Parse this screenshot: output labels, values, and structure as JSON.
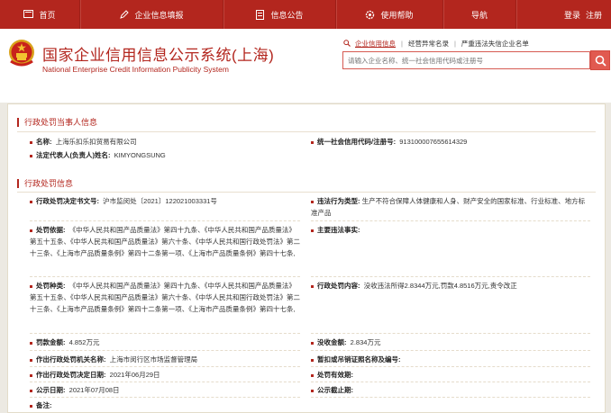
{
  "nav": {
    "items": [
      {
        "label": "首页",
        "icon": "home-icon"
      },
      {
        "label": "企业信息填报",
        "icon": "pencil-icon"
      },
      {
        "label": "信息公告",
        "icon": "document-icon"
      },
      {
        "label": "使用帮助",
        "icon": "gear-icon"
      },
      {
        "label": "导航",
        "icon": ""
      }
    ],
    "login": "登录",
    "register": "注册"
  },
  "header": {
    "title": "国家企业信用信息公示系统(上海)",
    "subtitle": "National Enterprise Credit Information Publicity System",
    "search_links": [
      "企业信用信息",
      "经营异常名录",
      "严重违法失信企业名单"
    ],
    "search_placeholder": "请输入企业名称、统一社会信用代码或注册号"
  },
  "party": {
    "section_title": "行政处罚当事人信息",
    "name_label": "名称:",
    "name_value": "上海乐扣乐扣贸易有限公司",
    "code_label": "统一社会信用代码/注册号:",
    "code_value": "91310000765561432​9",
    "rep_label": "法定代表人(负责人)姓名:",
    "rep_value": "KIMYONGSUNG"
  },
  "penalty": {
    "section_title": "行政处罚信息",
    "doc_label": "行政处罚决定书文号:",
    "doc_value": "沪市监闵处〔2021〕122021003331号",
    "violation_label": "违法行为类型:",
    "violation_value": "生产不符合保障人体健康和人身、财产安全的国家标准、行业标准、地方标准产品",
    "basis_label": "处罚依据:",
    "basis_value": "《中华人民共和国产品质量法》第四十九条、《中华人民共和国产品质量法》第五十五条、《中华人民共和国产品质量法》第六十条、《中华人民共和国行政处罚法》第二十三条、《上海市产品质量条例》第四十二条第一项、《上海市产品质量条例》第四十七条,",
    "facts_label": "主要违法事实:",
    "facts_value": "",
    "kind_label": "处罚种类:",
    "kind_value": "《中华人民共和国产品质量法》第四十九条、《中华人民共和国产品质量法》第五十五条、《中华人民共和国产品质量法》第六十条、《中华人民共和国行政处罚法》第二十三条、《上海市产品质量条例》第四十二条第一项、《上海市产品质量条例》第四十七条,",
    "content_label": "行政处罚内容:",
    "content_value": "没收违法所得2.8344万元,罚款4.8516万元,责令改正",
    "fine_label": "罚款金额:",
    "fine_value": "4.852万元",
    "confiscate_label": "没收金额:",
    "confiscate_value": "2.834万元",
    "org_label": "作出行政处罚机关名称:",
    "org_value": "上海市闵行区市场监督管理局",
    "revoke_label": "暂扣或吊销证照名称及编号:",
    "revoke_value": "",
    "date_label": "作出行政处罚决定日期:",
    "date_value": "2021年06月29日",
    "valid_label": "处罚有效期:",
    "valid_value": "",
    "pub_label": "公示日期:",
    "pub_value": "2021年07月08日",
    "pub_end_label": "公示截止期:",
    "pub_end_value": "",
    "remark_label": "备注:",
    "remark_value": ""
  }
}
